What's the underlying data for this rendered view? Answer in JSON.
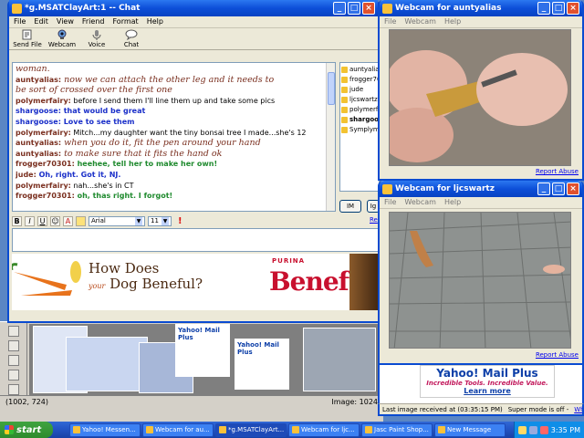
{
  "chat": {
    "title": "*g.MSATClayArt:1 -- Chat",
    "menu": [
      "File",
      "Edit",
      "View",
      "Friend",
      "Format",
      "Help"
    ],
    "toolbar": [
      "Send File",
      "Webcam",
      "Voice",
      "Chat"
    ],
    "transcript": [
      {
        "user": "",
        "text": "woman.",
        "color": "#7a2f1f",
        "script": true
      },
      {
        "user": "auntyalias:",
        "text": " now we can attach the other leg and it needs to",
        "color": "#7a2f1f",
        "ucolor": "#7a2f1f",
        "script": true
      },
      {
        "user": "",
        "text": "   be sort of crossed over the first one",
        "color": "#7a2f1f",
        "script": true
      },
      {
        "user": "polymerfairy:",
        "text": " before I send them I'll line them up and take some pics",
        "color": "#000",
        "ucolor": "#7a2f1f"
      },
      {
        "user": "shargoose:",
        "text": " that would be great",
        "color": "#1a2fc9",
        "ucolor": "#1a2fc9",
        "bold": true
      },
      {
        "user": "shargoose:",
        "text": " Love to see them",
        "color": "#1a2fc9",
        "ucolor": "#1a2fc9",
        "bold": true
      },
      {
        "user": "polymerfairy:",
        "text": " Mitch...my daughter want the tiny bonsai tree I made...she's 12",
        "color": "#000",
        "ucolor": "#7a2f1f"
      },
      {
        "user": "auntyalias:",
        "text": " when you do it, fit the pen around your hand",
        "color": "#7a2f1f",
        "ucolor": "#7a2f1f",
        "script": true
      },
      {
        "user": "auntyalias:",
        "text": " to make sure that it fits the hand ok",
        "color": "#7a2f1f",
        "ucolor": "#7a2f1f",
        "script": true
      },
      {
        "user": "frogger70301:",
        "text": " heehee, tell her to make her own!",
        "color": "#1f8a2e",
        "ucolor": "#7a2f1f",
        "bold": true
      },
      {
        "user": "jude:",
        "text": " Oh, right. Got it, NJ.",
        "color": "#1a2fc9",
        "ucolor": "#7a2f1f",
        "bold": true
      },
      {
        "user": "polymerfairy:",
        "text": " nah...she's in CT",
        "color": "#000",
        "ucolor": "#7a2f1f"
      },
      {
        "user": "frogger70301:",
        "text": " oh, thas right. I forgot!",
        "color": "#1f8a2e",
        "ucolor": "#7a2f1f",
        "bold": true
      }
    ],
    "users": [
      {
        "name": "auntyalias",
        "bold": false
      },
      {
        "name": "frogger703",
        "bold": false
      },
      {
        "name": "jude",
        "bold": false
      },
      {
        "name": "ljcswartz",
        "bold": false
      },
      {
        "name": "polymerfai",
        "bold": false
      },
      {
        "name": "shargoos",
        "bold": true
      },
      {
        "name": "Symplymac",
        "bold": false
      }
    ],
    "im_label": "IM",
    "ignore_label": "Ig",
    "report_label": "Re",
    "font": "Arial",
    "size": "11",
    "fmt": {
      "bold": "B",
      "italic": "I",
      "underline": "U"
    }
  },
  "ad": {
    "headline": "How Does",
    "sub_your": "your",
    "sub_main": "Dog Beneful?",
    "brand": "PURINA",
    "logo": "Beneful"
  },
  "cam1": {
    "title": "Webcam for auntyalias",
    "menu": [
      "File",
      "Webcam",
      "Help"
    ],
    "report": "Report Abuse"
  },
  "cam2": {
    "title": "Webcam for ljcswartz",
    "menu": [
      "File",
      "Webcam",
      "Help"
    ],
    "report": "Report Abuse"
  },
  "yahoo_ad": {
    "title": "Yahoo! Mail Plus",
    "tagline": "Incredible Tools. Incredible Value.",
    "link": "Learn more"
  },
  "cam_status": {
    "received": "Last image received at (03:35:15 PM)",
    "super": "Super mode is off -",
    "link": "What's this?"
  },
  "paintshop": {
    "coords": "(1002, 724)",
    "image": "Image: 1024",
    "thumb_text": "Yahoo! Mail Plus"
  },
  "taskbar": {
    "start": "start",
    "tasks": [
      "Yahoo! Messen...",
      "Webcam for au...",
      "*g.MSATClayArt...",
      "Webcam for ljc...",
      "Jasc Paint Shop...",
      "New Message"
    ],
    "active_index": 2,
    "clock": "3:35 PM"
  },
  "colors": {
    "xp_blue": "#0a4bd1",
    "script_text": "#7a2f1f",
    "chat_blue": "#1a2fc9",
    "chat_green": "#1f8a2e",
    "beneful_red": "#c8102e"
  }
}
